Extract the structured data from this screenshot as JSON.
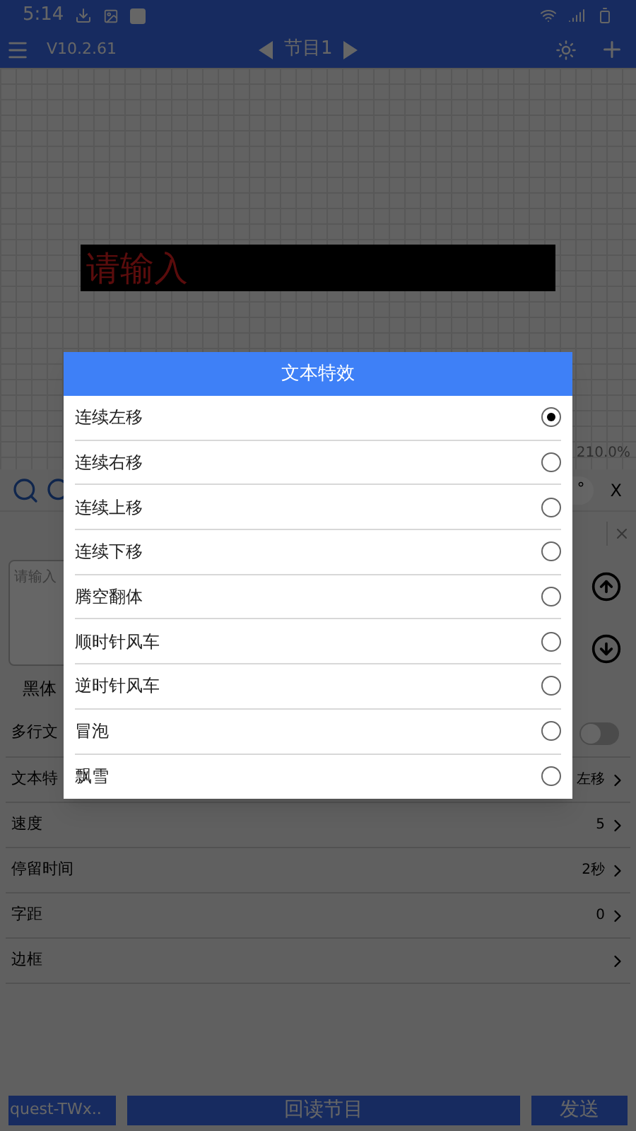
{
  "status_bar": {
    "time": "5:14"
  },
  "toolbar": {
    "version": "V10.2.61",
    "program": "节目1"
  },
  "canvas": {
    "preview_text": "请输入",
    "zoom": "210.0%"
  },
  "tools": {
    "angle": "°",
    "axis": "X"
  },
  "editor": {
    "placeholder": "请输入",
    "font": "黑体",
    "multiline_label": "多行文",
    "multiline_on": false
  },
  "settings": [
    {
      "label": "文本特",
      "value": "左移"
    },
    {
      "label": "速度",
      "value": "5"
    },
    {
      "label": "停留时间",
      "value": "2秒"
    },
    {
      "label": "字距",
      "value": "0"
    },
    {
      "label": "边框"
    }
  ],
  "bottom_buttons": [
    "quest-TWx..",
    "回读节目",
    "发送"
  ],
  "dialog": {
    "title": "文本特效",
    "options": [
      {
        "label": "连续左移",
        "selected": true
      },
      {
        "label": "连续右移",
        "selected": false
      },
      {
        "label": "连续上移",
        "selected": false
      },
      {
        "label": "连续下移",
        "selected": false
      },
      {
        "label": "腾空翻体",
        "selected": false
      },
      {
        "label": "顺时针风车",
        "selected": false
      },
      {
        "label": "逆时针风车",
        "selected": false
      },
      {
        "label": "冒泡",
        "selected": false
      },
      {
        "label": "飘雪",
        "selected": false
      }
    ]
  }
}
